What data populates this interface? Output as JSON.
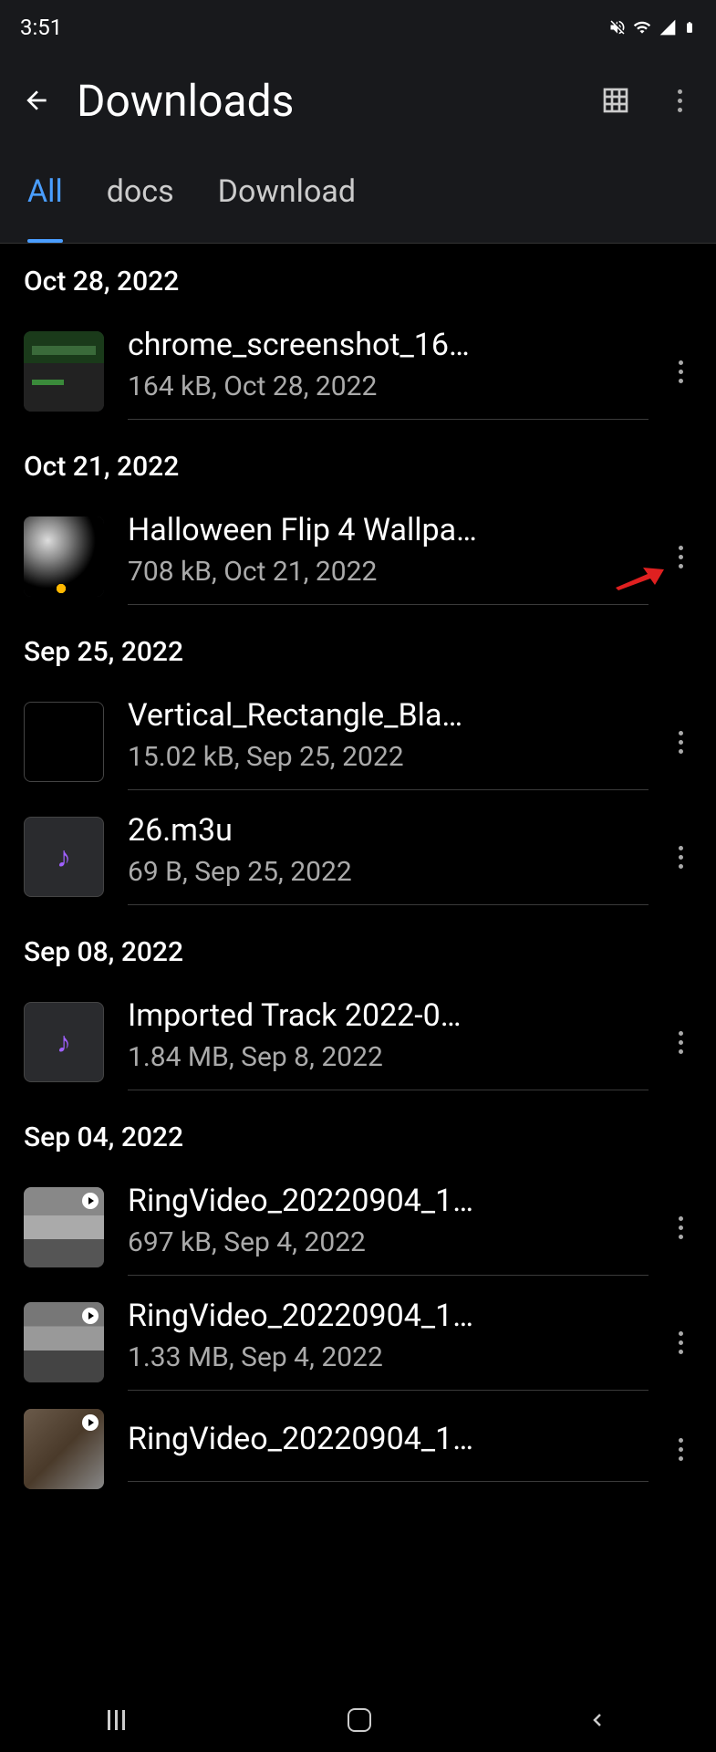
{
  "status": {
    "time": "3:51"
  },
  "header": {
    "title": "Downloads"
  },
  "tabs": [
    {
      "label": "All",
      "active": true
    },
    {
      "label": "docs",
      "active": false
    },
    {
      "label": "Download",
      "active": false
    }
  ],
  "groups": [
    {
      "date": "Oct 28, 2022",
      "files": [
        {
          "name": "chrome_screenshot_16…",
          "meta": "164 kB, Oct 28, 2022",
          "thumb": "screenshot"
        }
      ]
    },
    {
      "date": "Oct 21, 2022",
      "files": [
        {
          "name": "Halloween Flip 4 Wallpa…",
          "meta": "708 kB, Oct 21, 2022",
          "thumb": "halloween",
          "red_arrow": true
        }
      ]
    },
    {
      "date": "Sep 25, 2022",
      "files": [
        {
          "name": "Vertical_Rectangle_Bla…",
          "meta": "15.02 kB, Sep 25, 2022",
          "thumb": "empty"
        },
        {
          "name": "26.m3u",
          "meta": "69 B, Sep 25, 2022",
          "thumb": "music"
        }
      ]
    },
    {
      "date": "Sep 08, 2022",
      "files": [
        {
          "name": "Imported Track 2022-0…",
          "meta": "1.84 MB, Sep 8, 2022",
          "thumb": "music"
        }
      ]
    },
    {
      "date": "Sep 04, 2022",
      "files": [
        {
          "name": "RingVideo_20220904_1…",
          "meta": "697 kB, Sep 4, 2022",
          "thumb": "video1"
        },
        {
          "name": "RingVideo_20220904_1…",
          "meta": "1.33 MB, Sep 4, 2022",
          "thumb": "video2"
        },
        {
          "name": "RingVideo_20220904_1…",
          "meta": "",
          "thumb": "video3"
        }
      ]
    }
  ]
}
